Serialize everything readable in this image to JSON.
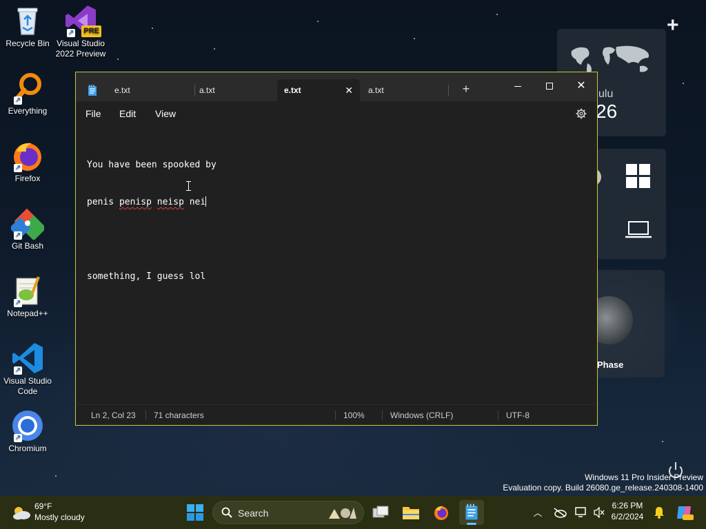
{
  "desktop": {
    "icons": [
      {
        "label": "Recycle Bin"
      },
      {
        "label": "Visual Studio 2022 Preview",
        "badge": "PRE"
      },
      {
        "label": "Everything"
      },
      {
        "label": "Firefox"
      },
      {
        "label": "Git Bash"
      },
      {
        "label": "Notepad++"
      },
      {
        "label": "Visual Studio Code"
      },
      {
        "label": "Chromium"
      }
    ]
  },
  "widgets": {
    "add_symbol": "+",
    "clock_partial_label": "ulu",
    "clock_partial_value": "26",
    "moon_label": "Phase"
  },
  "notepad": {
    "tabs": [
      {
        "label": "e.txt",
        "active": false
      },
      {
        "label": "a.txt",
        "active": false
      },
      {
        "label": "e.txt",
        "active": true
      },
      {
        "label": "a.txt",
        "active": false
      }
    ],
    "new_tab_symbol": "+",
    "menu": {
      "file": "File",
      "edit": "Edit",
      "view": "View"
    },
    "content": {
      "line1": "You have been spooked by",
      "line2_a": "penis ",
      "line2_b": "penisp",
      "line2_c": " ",
      "line2_d": "neisp",
      "line2_e": " nei",
      "line3": "",
      "line4": "something, I guess lol"
    },
    "status": {
      "position": "Ln 2, Col 23",
      "characters": "71 characters",
      "zoom": "100%",
      "line_ending": "Windows (CRLF)",
      "encoding": "UTF-8"
    }
  },
  "watermark": {
    "line1": "Windows 11 Pro Insider Preview",
    "line2": "Evaluation copy. Build 26080.ge_release.240308-1400"
  },
  "taskbar": {
    "weather_temp": "69°F",
    "weather_desc": "Mostly cloudy",
    "search_label": "Search",
    "time": "6:26 PM",
    "date": "6/2/2024",
    "accent": "#c8c83a"
  }
}
